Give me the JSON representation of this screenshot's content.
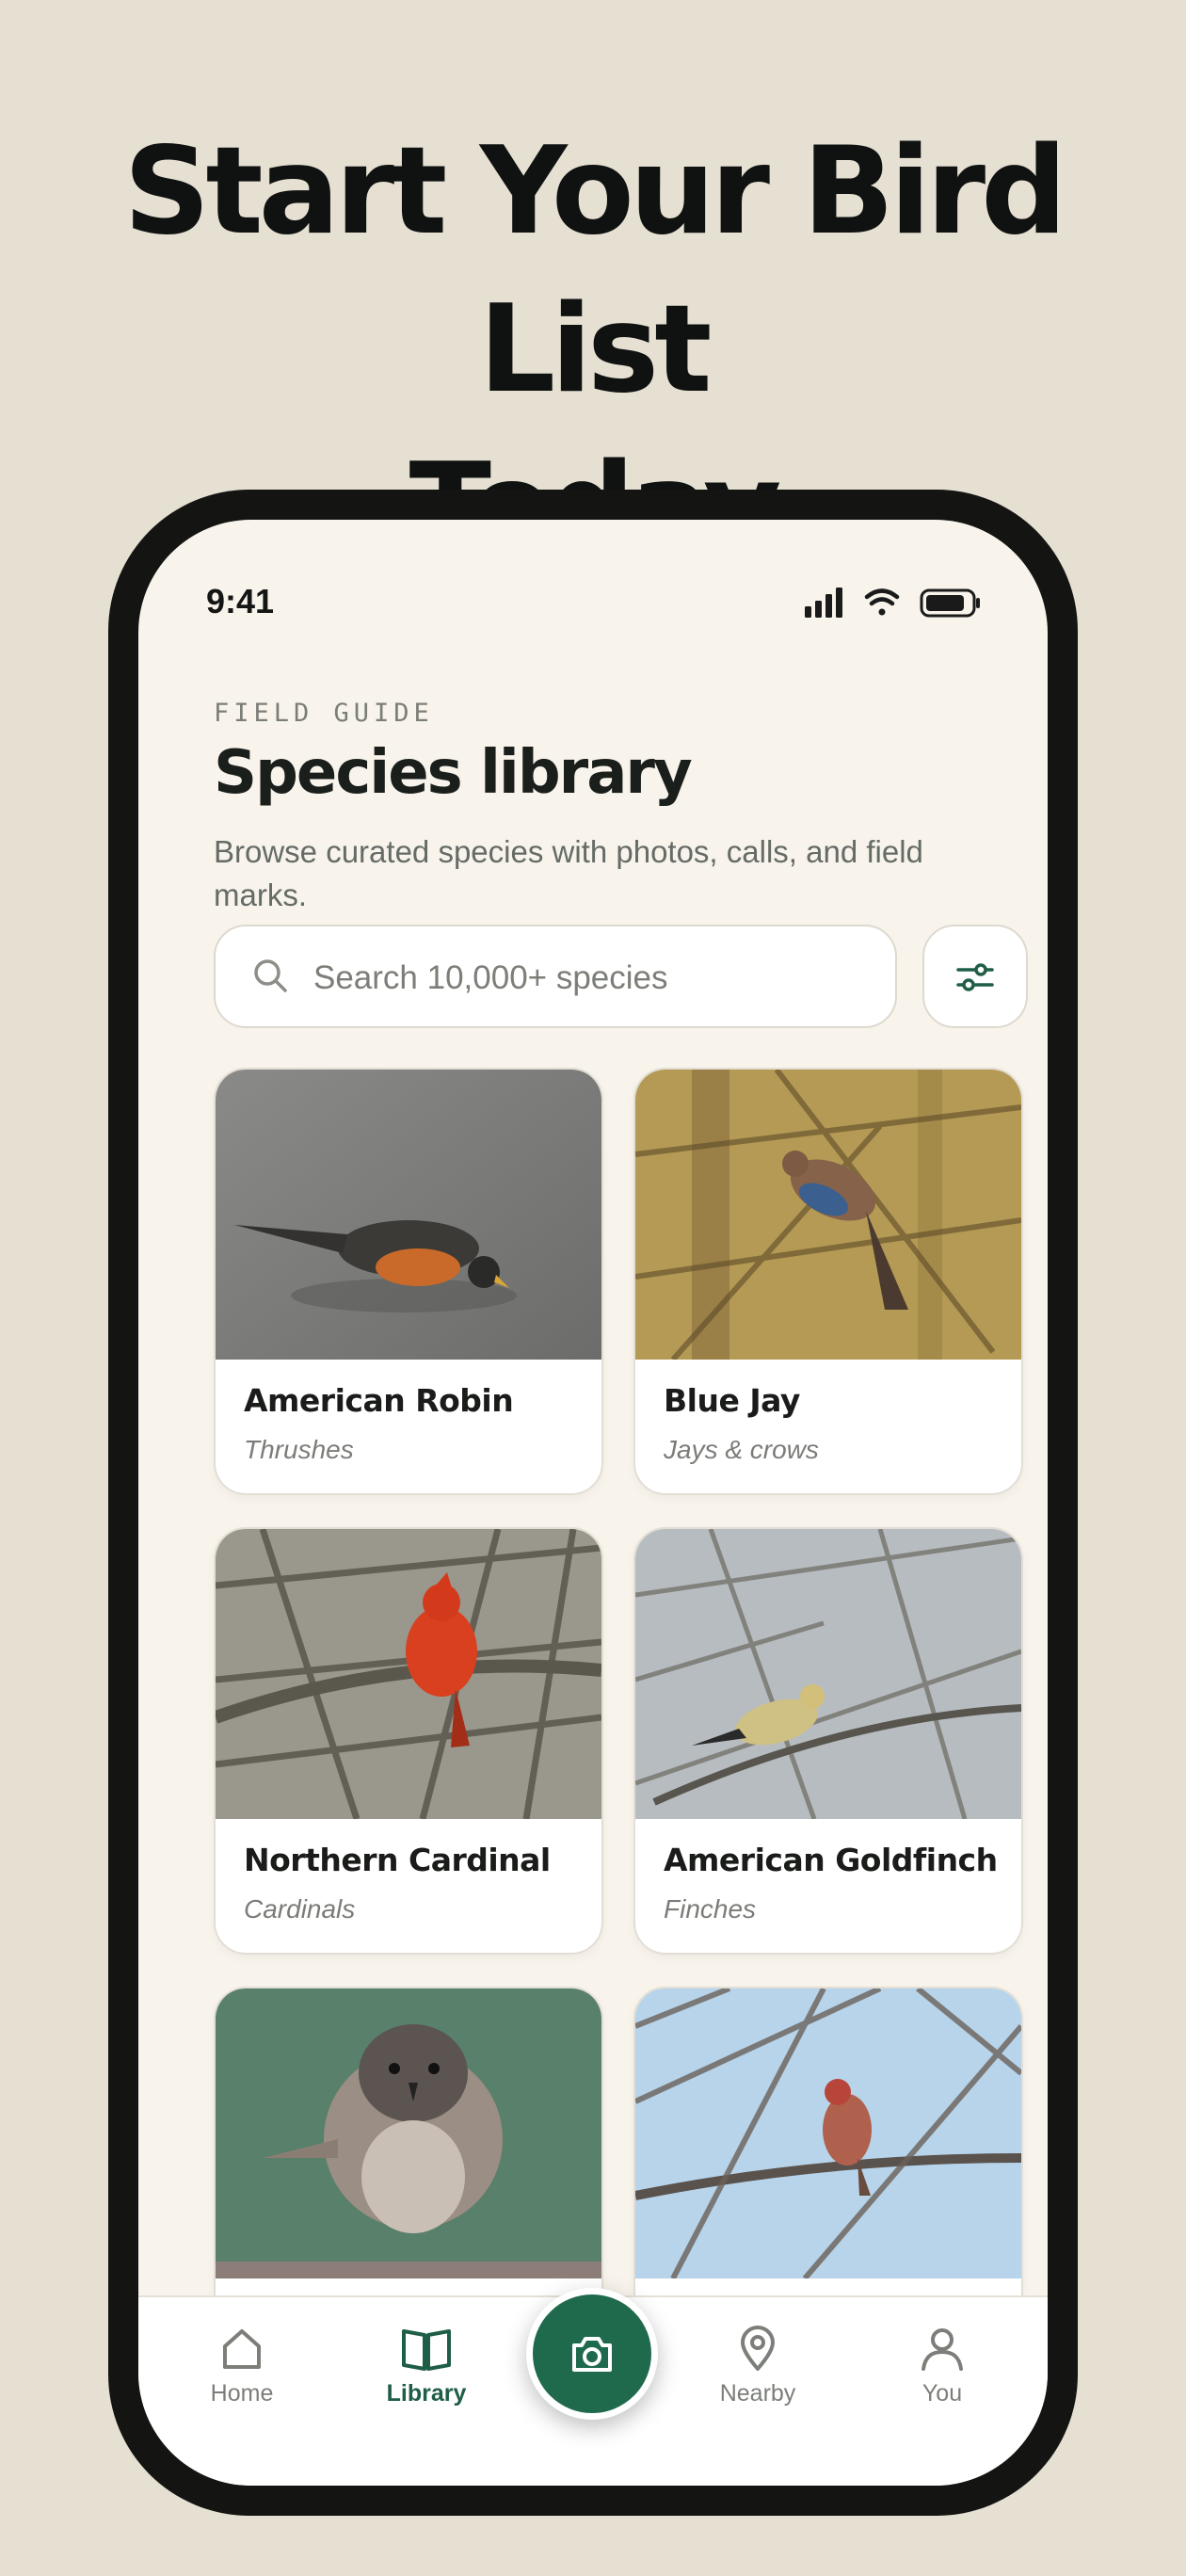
{
  "headline": {
    "line1": "Start Your Bird List",
    "line2": "Today"
  },
  "status_bar": {
    "time": "9:41"
  },
  "header": {
    "eyebrow": "FIELD GUIDE",
    "title": "Species library",
    "subtitle": "Browse curated species with photos, calls, and field marks."
  },
  "search": {
    "placeholder": "Search 10,000+ species",
    "value": ""
  },
  "species": [
    {
      "name": "American Robin",
      "family": "Thrushes"
    },
    {
      "name": "Blue Jay",
      "family": "Jays & crows"
    },
    {
      "name": "Northern Cardinal",
      "family": "Cardinals"
    },
    {
      "name": "American Goldfinch",
      "family": "Finches"
    },
    {
      "name": "",
      "family": ""
    },
    {
      "name": "",
      "family": ""
    }
  ],
  "tabs": [
    {
      "label": "Home",
      "icon": "home-icon"
    },
    {
      "label": "Library",
      "icon": "book-icon",
      "active": true
    },
    {
      "label": "Nearby",
      "icon": "location-pin-icon"
    },
    {
      "label": "You",
      "icon": "person-icon"
    }
  ],
  "colors": {
    "accent": "#1f6a4d",
    "background": "#e6e0d3",
    "screen": "#f8f4ec"
  }
}
